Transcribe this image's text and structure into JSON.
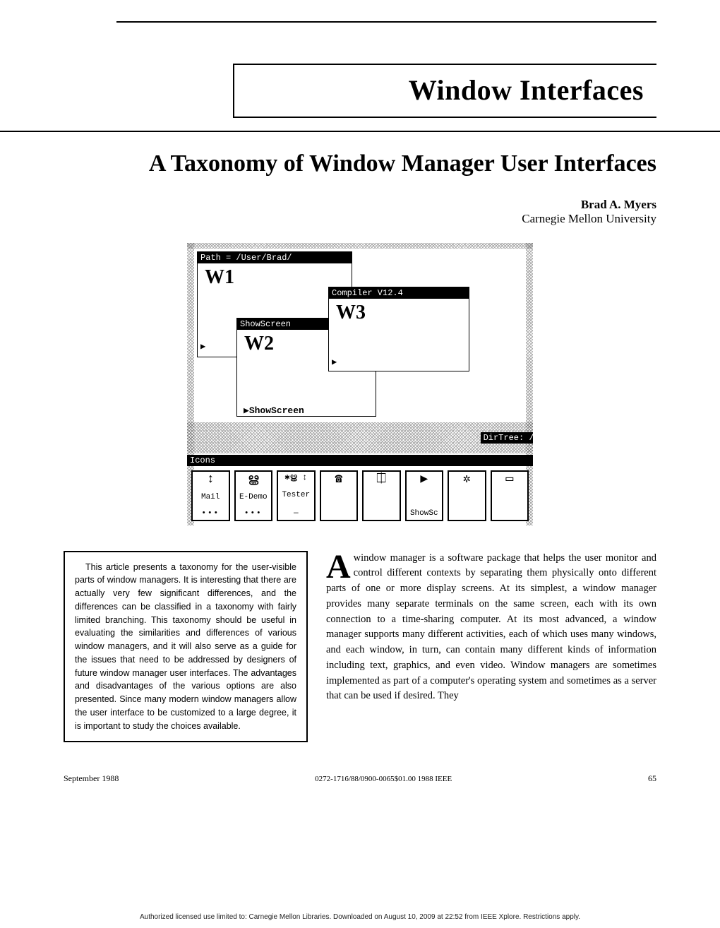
{
  "header": {
    "series_title": "Window Interfaces",
    "article_title": "A Taxonomy of Window Manager User Interfaces",
    "author_name": "Brad A. Myers",
    "author_affiliation": "Carnegie Mellon University"
  },
  "figure": {
    "w1": {
      "titlebar": "Path = /User/Brad/",
      "label": "W1"
    },
    "w2": {
      "titlebar": "ShowScreen",
      "label": "W2",
      "ground_label": "▶ShowScreen"
    },
    "w3": {
      "titlebar": "Compiler V12.4",
      "label": "W3"
    },
    "dirtree_title": "DirTree: /Sa",
    "icons_title": "Icons",
    "icons": [
      {
        "glyph": "↕",
        "label": "Mail",
        "sub": "•••"
      },
      {
        "glyph": "ൠ",
        "label": "E-Demo",
        "sub": "•••"
      },
      {
        "glyph": "✱ൠ ↕",
        "label": "Tester",
        "sub": "—"
      },
      {
        "glyph": "☎",
        "label": "",
        "sub": ""
      },
      {
        "glyph": "⎅",
        "label": "",
        "sub": ""
      },
      {
        "glyph": "▶",
        "label": "ShowSc",
        "sub": ""
      },
      {
        "glyph": "✲",
        "label": "",
        "sub": ""
      },
      {
        "glyph": "▭",
        "label": "",
        "sub": ""
      }
    ]
  },
  "abstract": {
    "text": "This article presents a taxonomy for the user-visible parts of window managers. It is interesting that there are actually very few significant differences, and the differences can be classified in a taxonomy with fairly limited branching. This taxonomy should be useful in evaluating the similarities and differences of various window managers, and it will also serve as a guide for the issues that need to be addressed by designers of future window manager user interfaces. The advantages and disadvantages of the various options are also presented. Since many modern window managers allow the user interface to be customized to a large degree, it is important to study the choices available."
  },
  "body": {
    "dropcap": "A",
    "text": " window manager is a software package that helps the user monitor and control different contexts by separating them physically onto different parts of one or more display screens. At its simplest, a window manager provides many separate terminals on the same screen, each with its own connection to a time-sharing computer. At its most advanced, a window manager supports many different activities, each of which uses many windows, and each window, in turn, can contain many different kinds of information including text, graphics, and even video. Window managers are sometimes implemented as part of a computer's operating system and sometimes as a server that can be used if desired. They"
  },
  "footer": {
    "left": "September 1988",
    "mid": "0272-1716/88/0900-0065$01.00   1988 IEEE",
    "right": "65"
  },
  "license": "Authorized licensed use limited to: Carnegie Mellon Libraries. Downloaded on August 10, 2009 at 22:52 from IEEE Xplore.  Restrictions apply."
}
